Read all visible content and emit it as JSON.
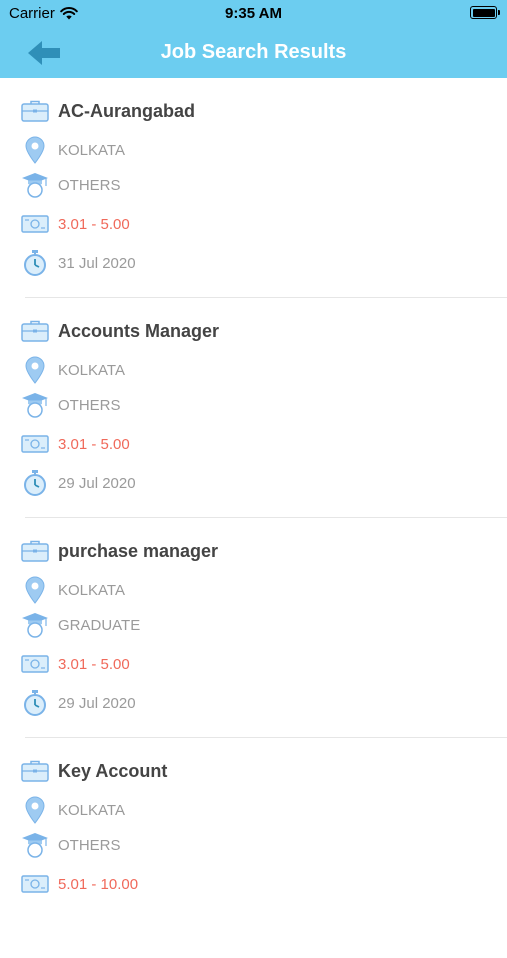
{
  "status": {
    "carrier": "Carrier",
    "time": "9:35 AM"
  },
  "header": {
    "title": "Job Search Results"
  },
  "colors": {
    "accent": "#6ccdf0",
    "icon": "#7ab3e8",
    "salary": "#f0695a"
  },
  "jobs": [
    {
      "title": "AC-Aurangabad",
      "location": "KOLKATA",
      "qualification": "OTHERS",
      "salary": "3.01 - 5.00",
      "date": "31 Jul 2020"
    },
    {
      "title": "Accounts Manager",
      "location": "KOLKATA",
      "qualification": "OTHERS",
      "salary": "3.01 - 5.00",
      "date": "29 Jul 2020"
    },
    {
      "title": "purchase manager",
      "location": "KOLKATA",
      "qualification": "GRADUATE",
      "salary": "3.01 - 5.00",
      "date": "29 Jul 2020"
    },
    {
      "title": "Key Account",
      "location": "KOLKATA",
      "qualification": "OTHERS",
      "salary": "5.01 - 10.00",
      "date": ""
    }
  ],
  "icons": {
    "title": "briefcase-icon",
    "location": "location-pin-icon",
    "qualification": "graduate-icon",
    "salary": "money-icon",
    "date": "stopwatch-icon"
  }
}
